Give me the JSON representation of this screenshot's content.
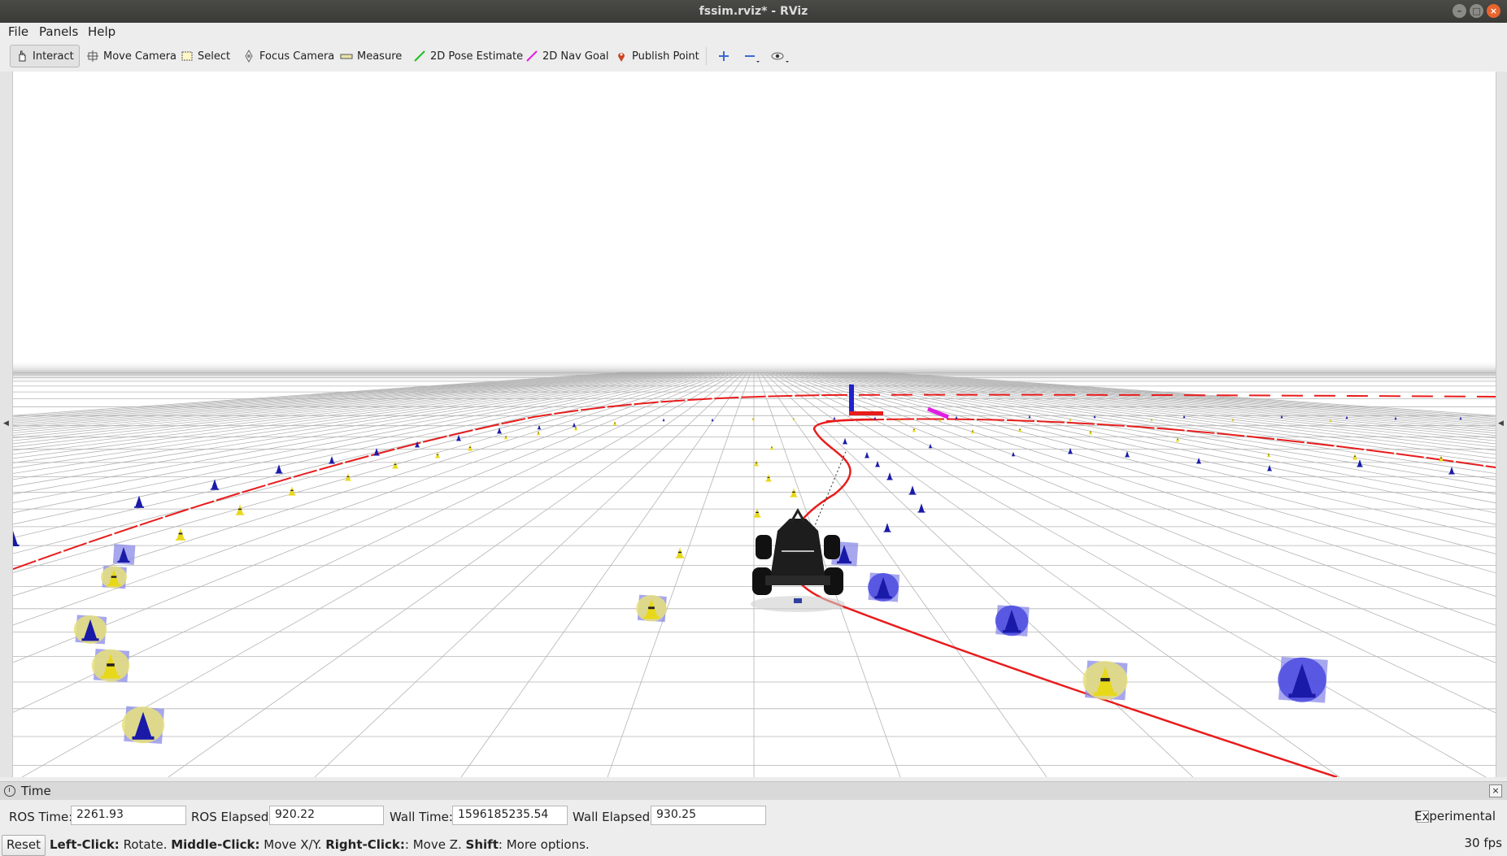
{
  "window": {
    "title": "fssim.rviz* - RViz"
  },
  "menu": {
    "items": [
      "File",
      "Panels",
      "Help"
    ]
  },
  "toolbar": {
    "tools": [
      {
        "label": "Interact",
        "icon": "hand-icon",
        "active": true
      },
      {
        "label": "Move Camera",
        "icon": "move-camera-icon"
      },
      {
        "label": "Select",
        "icon": "select-box-icon"
      },
      {
        "label": "Focus Camera",
        "icon": "focus-camera-icon"
      },
      {
        "label": "Measure",
        "icon": "ruler-icon"
      },
      {
        "label": "2D Pose Estimate",
        "icon": "green-arrow-icon"
      },
      {
        "label": "2D Nav Goal",
        "icon": "magenta-arrow-icon"
      },
      {
        "label": "Publish Point",
        "icon": "map-pin-icon"
      }
    ],
    "extra_icons": [
      "plus-icon",
      "minus-icon",
      "eye-icon"
    ]
  },
  "scene": {
    "colors": {
      "path": "#e81c1c",
      "blue_cone": "#1a1aa8",
      "yellow_cone": "#e8d81a",
      "grid": "#b4b4b4"
    }
  },
  "time_panel": {
    "title": "Time",
    "ros_time_label": "ROS Time:",
    "ros_time": "2261.93",
    "ros_elapsed_label": "ROS Elapsed:",
    "ros_elapsed": "920.22",
    "wall_time_label": "Wall Time:",
    "wall_time": "1596185235.54",
    "wall_elapsed_label": "Wall Elapsed:",
    "wall_elapsed": "930.25",
    "experimental_label": "Experimental"
  },
  "status": {
    "reset_label": "Reset",
    "hint_parts": [
      "Left-Click:",
      " Rotate. ",
      "Middle-Click:",
      " Move X/Y. ",
      "Right-Click:",
      ": Move Z. ",
      "Shift",
      ": More options."
    ],
    "fps": "30 fps"
  }
}
